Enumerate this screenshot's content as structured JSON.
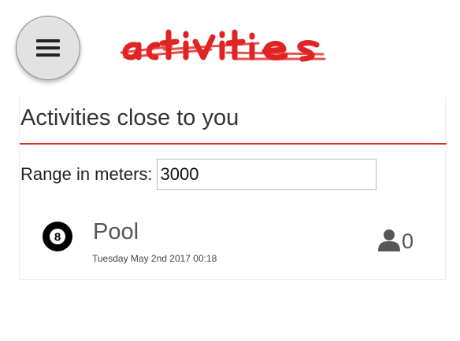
{
  "header": {
    "menu_icon": "hamburger-menu-icon",
    "logo_text": "activities",
    "logo_color": "#e02424"
  },
  "section": {
    "title": "Activities close to you"
  },
  "range": {
    "label": "Range in meters:",
    "value": "3000"
  },
  "activities": [
    {
      "icon": "eight-ball-icon",
      "name": "Pool",
      "date": "Tuesday May 2nd 2017 00:18",
      "participants_icon": "user-icon",
      "participants": "0"
    }
  ],
  "colors": {
    "accent": "#d9342b"
  }
}
